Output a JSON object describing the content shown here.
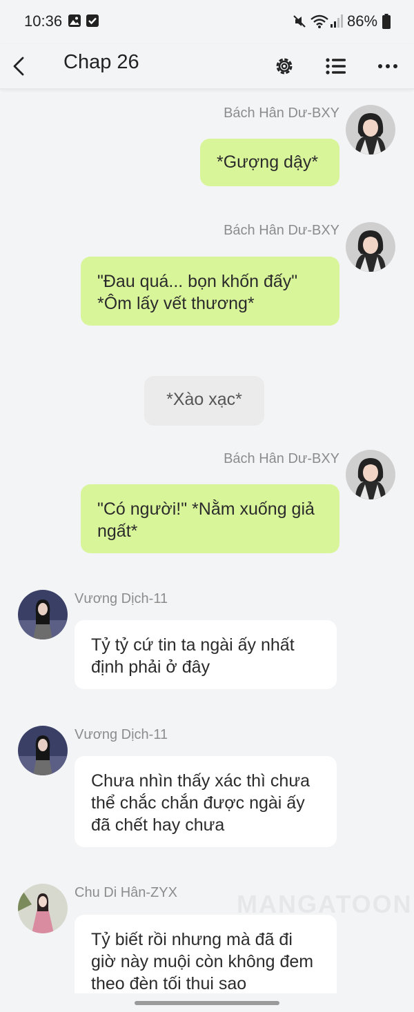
{
  "status": {
    "time": "10:36",
    "battery": "86%",
    "left_icons": [
      "image-icon",
      "check-square-icon"
    ],
    "right_icons": [
      "mute-icon",
      "wifi-icon",
      "signal-icon",
      "battery-icon"
    ]
  },
  "header": {
    "title": "Chap 26",
    "back_icon": "chevron-left-icon",
    "actions": [
      "settings-icon",
      "list-icon",
      "more-icon"
    ]
  },
  "messages": [
    {
      "side": "right",
      "author": "Bách Hân Dư-BXY",
      "text": "*Gượng dậy*"
    },
    {
      "side": "right",
      "author": "Bách Hân Dư-BXY",
      "text": "\"Đau quá... bọn khốn đấy\" *Ôm lấy vết thương*"
    },
    {
      "side": "narration",
      "text": "*Xào xạc*"
    },
    {
      "side": "right",
      "author": "Bách Hân Dư-BXY",
      "text": "\"Có người!\" *Nằm xuống giả ngất*"
    },
    {
      "side": "left",
      "author": "Vương Dịch-11",
      "text": "Tỷ tỷ cứ tin ta ngài ấy nhất định phải ở đây"
    },
    {
      "side": "left",
      "author": "Vương Dịch-11",
      "text": "Chưa nhìn thấy xác thì chưa thể chắc chắn được ngài ấy đã chết hay chưa"
    },
    {
      "side": "left",
      "author": "Chu Di Hân-ZYX",
      "text": "Tỷ biết rồi nhưng mà đã đi giờ này muội còn không đem theo đèn tối thui sao"
    }
  ],
  "watermark": "MANGATOON",
  "colors": {
    "background": "#f3f4f6",
    "right_bubble": "#d9f59a",
    "left_bubble": "#ffffff",
    "narration_bubble": "#ebebeb",
    "name_text": "#8c8c8c"
  }
}
